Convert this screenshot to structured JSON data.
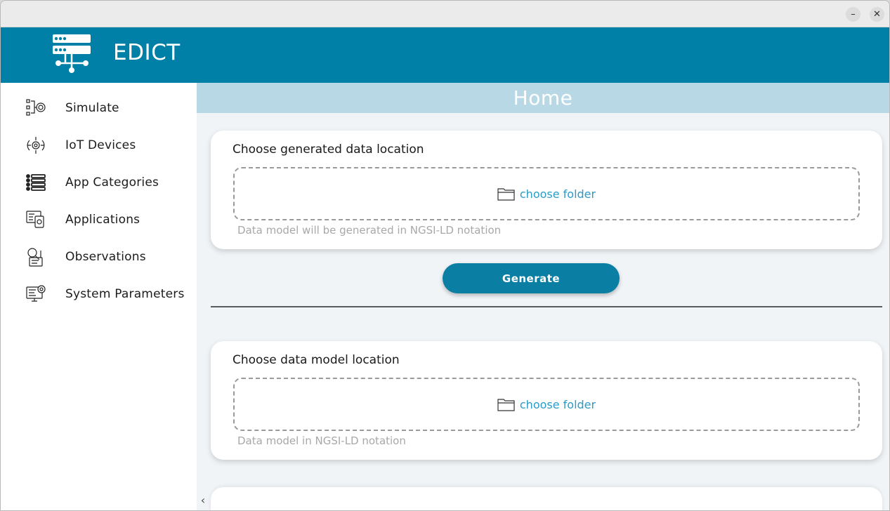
{
  "window": {
    "minimize": "–",
    "close": "✕"
  },
  "header": {
    "title": "EDICT",
    "logo": "server-network-icon"
  },
  "sidebar": {
    "items": [
      {
        "label": "Simulate",
        "icon": "simulate-icon"
      },
      {
        "label": "IoT Devices",
        "icon": "iot-devices-icon"
      },
      {
        "label": "App Categories",
        "icon": "list-icon"
      },
      {
        "label": "Applications",
        "icon": "applications-icon"
      },
      {
        "label": "Observations",
        "icon": "observations-icon"
      },
      {
        "label": "System Parameters",
        "icon": "system-parameters-icon"
      }
    ]
  },
  "main": {
    "page_title": "Home",
    "generate_card": {
      "title": "Choose generated data location",
      "choose_label": "choose folder",
      "helper": "Data model will be generated in NGSI-LD notation"
    },
    "generate_button": "Generate",
    "model_card": {
      "title": "Choose data model location",
      "choose_label": "choose folder",
      "helper": "Data model in NGSI-LD notation"
    },
    "scroll_left": "‹"
  },
  "colors": {
    "header": "#0080a6",
    "title_bar": "#b8d8e5",
    "accent_link": "#2a9bc7",
    "button": "#0a7ea3",
    "main_bg": "#f0f4f7"
  }
}
